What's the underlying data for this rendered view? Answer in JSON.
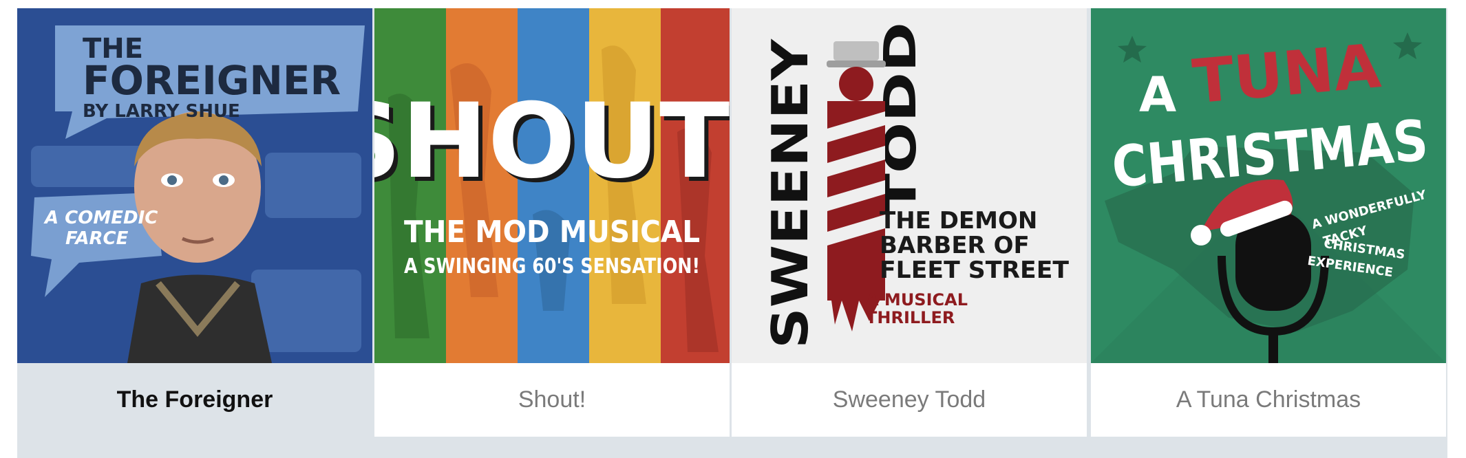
{
  "shows": [
    {
      "title": "The Foreigner",
      "active": true,
      "art": {
        "line1": "THE",
        "line2": "FOREIGNER",
        "line3": "BY LARRY SHUE",
        "bubble1": "A COMEDIC",
        "bubble2": "FARCE"
      }
    },
    {
      "title": "Shout!",
      "active": false,
      "art": {
        "big": "SHOUT!",
        "sub1": "THE MOD MUSICAL",
        "sub2": "A SWINGING 60'S SENSATION!"
      }
    },
    {
      "title": "Sweeney Todd",
      "active": false,
      "art": {
        "vert1": "SWEENEY",
        "vert2": "TODD",
        "tag1": "THE DEMON",
        "tag2": "BARBER OF",
        "tag3": "FLEET STREET",
        "red1": "A MUSICAL",
        "red2": "THRILLER"
      }
    },
    {
      "title": "A Tuna Christmas",
      "active": false,
      "art": {
        "a": "A",
        "tuna": "TUNA",
        "christmas": "CHRISTMAS",
        "side1": "A WONDERFULLY",
        "side2": "TACKY",
        "side3": "CHRISTMAS",
        "side4": "EXPERIENCE"
      }
    }
  ],
  "colors": {
    "strip": "#dde3e8",
    "foreigner_bg": "#2b4e93",
    "shout_stripes": [
      "#3e8b3a",
      "#e27b33",
      "#3f84c6",
      "#e8b63c",
      "#c23f30"
    ],
    "sweeney_red": "#8e1b1f",
    "tuna_bg": "#2e8a62"
  }
}
